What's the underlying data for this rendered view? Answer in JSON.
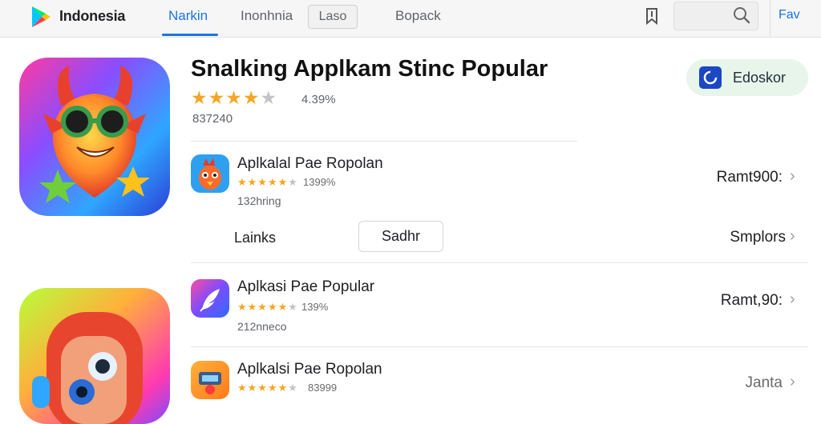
{
  "header": {
    "brand": "Indonesia",
    "tabs": [
      {
        "label": "Narkin",
        "active": true
      },
      {
        "label": "Inonhnia",
        "active": false
      }
    ],
    "laso_label": "Laso",
    "bopack_label": "Bopack",
    "search_placeholder": "",
    "fav_label": "Fav",
    "accent": "#1a73e8"
  },
  "hero": {
    "title": "Snalking Applkam Stinc Popular",
    "stars": "★★★★",
    "star_empty": "★",
    "rating": "4.39%",
    "count": "837240",
    "install_label": "Edoskor",
    "install_bg": "#e7f5ea"
  },
  "items": [
    {
      "title": "Aplkalal Pae Ropolan",
      "stars": "★★★★★",
      "star_empty": "★",
      "rating": "1399%",
      "sub": "132hring",
      "right": "Ramt900:",
      "icon": "bird-icon"
    },
    {
      "title": "Aplkasi Pae Popular",
      "stars": "★★★★★",
      "star_empty": "★",
      "rating": "139%",
      "sub": "212nneco",
      "right": "Ramt,90:",
      "icon": "feather-icon"
    },
    {
      "title": "Aplkalsi Pae Ropolan",
      "stars": "★★★★★",
      "star_empty": "★",
      "rating": "83999",
      "sub": "",
      "right": "Janta",
      "icon": "game-icon"
    }
  ],
  "row2": {
    "left_label": "Lainks",
    "button_label": "Sadhr",
    "right_label": "Smplors"
  },
  "chevron": "›"
}
